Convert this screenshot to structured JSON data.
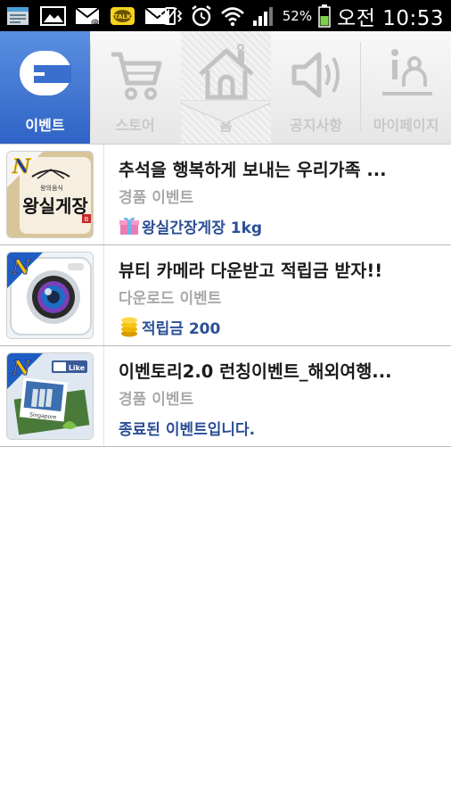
{
  "status_bar": {
    "battery_percent": "52%",
    "time": "오전 10:53",
    "icons": [
      "notes-icon",
      "gallery-icon",
      "mail-missed-icon",
      "kakaotalk-icon",
      "email-icon",
      "vibrate-icon",
      "alarm-icon",
      "wifi-icon",
      "signal-icon",
      "battery-icon"
    ],
    "kakao_badge": "TALK"
  },
  "tabs": [
    {
      "label": "이벤트",
      "icon": "event-logo-icon",
      "active": true
    },
    {
      "label": "스토어",
      "icon": "cart-icon",
      "active": false
    },
    {
      "label": "홈",
      "icon": "home-icon",
      "active": false
    },
    {
      "label": "공지사항",
      "icon": "speaker-icon",
      "active": false
    },
    {
      "label": "마이페이지",
      "icon": "person-info-icon",
      "active": false
    }
  ],
  "events": [
    {
      "title": "추석을 행복하게 보내는 우리가족 ...",
      "type": "경품 이벤트",
      "reward_icon": "gift-icon",
      "reward": "왕실간장게장 1kg",
      "thumb_badge": "N",
      "thumb_text": "왕실게장",
      "thumb_subtext": "왕의음식",
      "thumb_mark": "B"
    },
    {
      "title": "뷰티 카메라 다운받고 적립금 받자!!",
      "type": "다운로드 이벤트",
      "reward_icon": "coin-stack-icon",
      "reward": "적립금 200",
      "thumb_badge": "N"
    },
    {
      "title": "이벤토리2.0 런칭이벤트_해외여행...",
      "type": "경품 이벤트",
      "reward_icon": "",
      "reward": "종료된 이벤트입니다.",
      "thumb_badge": "N",
      "thumb_like": "Like",
      "thumb_caption": "Singapore"
    }
  ],
  "colors": {
    "active_tab": "#3a6fd0",
    "reward_text": "#2b4e96",
    "subtitle_text": "#a9a9a9",
    "inactive_tab": "#c8c8c8"
  }
}
